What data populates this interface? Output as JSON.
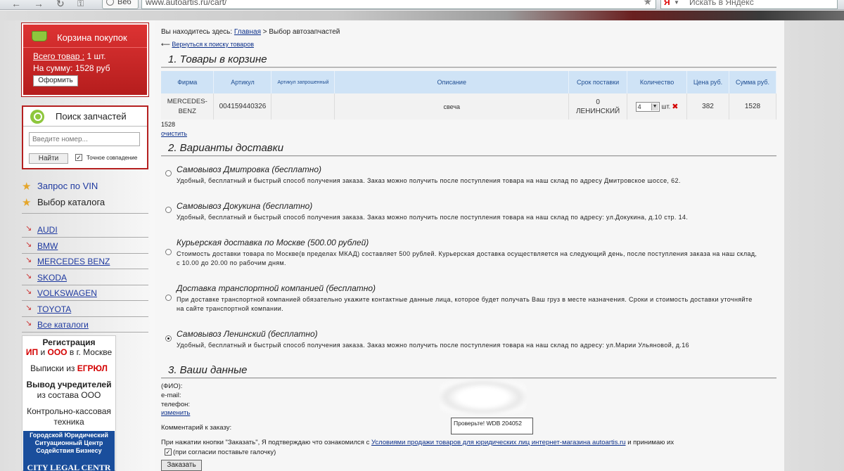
{
  "browser": {
    "tab_label": "Веб",
    "url": "www.autoartis.ru/cart/",
    "search_placeholder": "Искать в Яндекс"
  },
  "sidebar": {
    "cart": {
      "title": "Корзина покупок",
      "total_items_label": "Всего товар :",
      "total_items_value": "1 шт.",
      "sum_label": "На сумму:",
      "sum_value": "1528 руб",
      "checkout_button": "Оформить"
    },
    "search": {
      "title": "Поиск запчастей",
      "placeholder": "Введите номер...",
      "find_button": "Найти",
      "exact_match_label": "Точное совпадение",
      "exact_match_checked": true
    },
    "links": [
      {
        "label": "Запрос по VIN"
      },
      {
        "label": "Выбор каталога"
      }
    ],
    "brands": [
      "AUDI",
      "BMW",
      "MERCEDES BENZ",
      "SKODA",
      "VOLKSWAGEN",
      "TOYOTA",
      "Все каталоги"
    ],
    "ad": {
      "line1": "Регистрация",
      "line2a": "ИП",
      "line2b": "и",
      "line2c": "ООО",
      "line2d": "в г. Москве",
      "line3a": "Выписки из",
      "line3b": "ЕГРЮЛ",
      "line4": "Вывод учредителей",
      "line5": "из состава ООО",
      "line6": "Контрольно-кассовая",
      "line7": "техника",
      "blue": "Городской Юридический Ситуационный Центр Содействия Бизнесу",
      "logo": "CITY LEGAL CENTR"
    }
  },
  "main": {
    "breadcrumb": {
      "prefix": "Вы находитесь здесь:",
      "home": "Главная",
      "sep": ">",
      "current": "Выбор автозапчастей"
    },
    "back_link": "Вернуться к поиску товаров",
    "section1": "1. Товары в корзине",
    "cart_table": {
      "headers": [
        "Фирма",
        "Артикул",
        "Артикул запрошенный",
        "Описание",
        "Срок поставки",
        "Количество",
        "Цена руб.",
        "Сумма руб."
      ],
      "row": {
        "brand": "MERCEDES-BENZ",
        "article": "004159440326",
        "requested": "",
        "description": "свеча",
        "delivery_days": "0",
        "delivery_place": "ЛЕНИНСКИЙ",
        "qty": "4",
        "unit": "шт.",
        "price": "382",
        "total": "1528"
      }
    },
    "cart_sum": "1528",
    "clear_link": "очистить",
    "section2": "2. Варианты доставки",
    "delivery": [
      {
        "title": "Самовывоз Дмитровка (бесплатно)",
        "desc": "Удобный, бесплатный и быстрый способ получения заказа. Заказ можно получить после поступления товара на наш склад по адресу Дмитровское шоссе, 62.",
        "selected": false
      },
      {
        "title": "Самовывоз Докукина (бесплатно)",
        "desc": "Удобный, бесплатный и быстрый способ получения заказа. Заказ можно получить после поступления товара на наш склад по адресу: ул.Докукина, д.10 стр. 14.",
        "selected": false
      },
      {
        "title": "Курьерская доставка по Москве (500.00 рублей)",
        "desc": "Стоимость доставки товара по Москве(в пределах МКАД) составляет 500 рублей. Курьерская доставка осуществляется на следующий день, после поступления заказа на наш склад, с 10.00 до 20.00 по рабочим дням.",
        "selected": false
      },
      {
        "title": "Доставка транспортной компанией (бесплатно)",
        "desc": "При доставке транспортной компанией обязательно укажите контактные данные лица, которое будет получать Ваш груз в месте назначения. Сроки и стоимость доставки уточняйте на сайте транспортной компании.",
        "selected": false
      },
      {
        "title": "Самовывоз Ленинский (бесплатно)",
        "desc": "Удобный, бесплатный и быстрый способ получения заказа. Заказ можно получить после поступления товара на наш склад по адресу: ул.Марии Ульяновой, д.16",
        "selected": true
      }
    ],
    "section3": "3. Ваши данные",
    "fields": {
      "fio": "(ФИО):",
      "email": "e-mail:",
      "phone": "телефон:",
      "edit_link": "изменить",
      "comment_label": "Комментарий к заказу:",
      "comment_value": "Проверьте! WDB 204052"
    },
    "terms_prefix": "При нажатии кнопки \"Заказать\", Я подтверждаю что ознакомился с",
    "terms_link": "Условиями продажи товаров для юридических лиц интернет-магазина autoartis.ru",
    "terms_suffix": "и принимаю их",
    "agree_label": "(при согласии поставьте галочку)",
    "order_button": "Заказать"
  }
}
